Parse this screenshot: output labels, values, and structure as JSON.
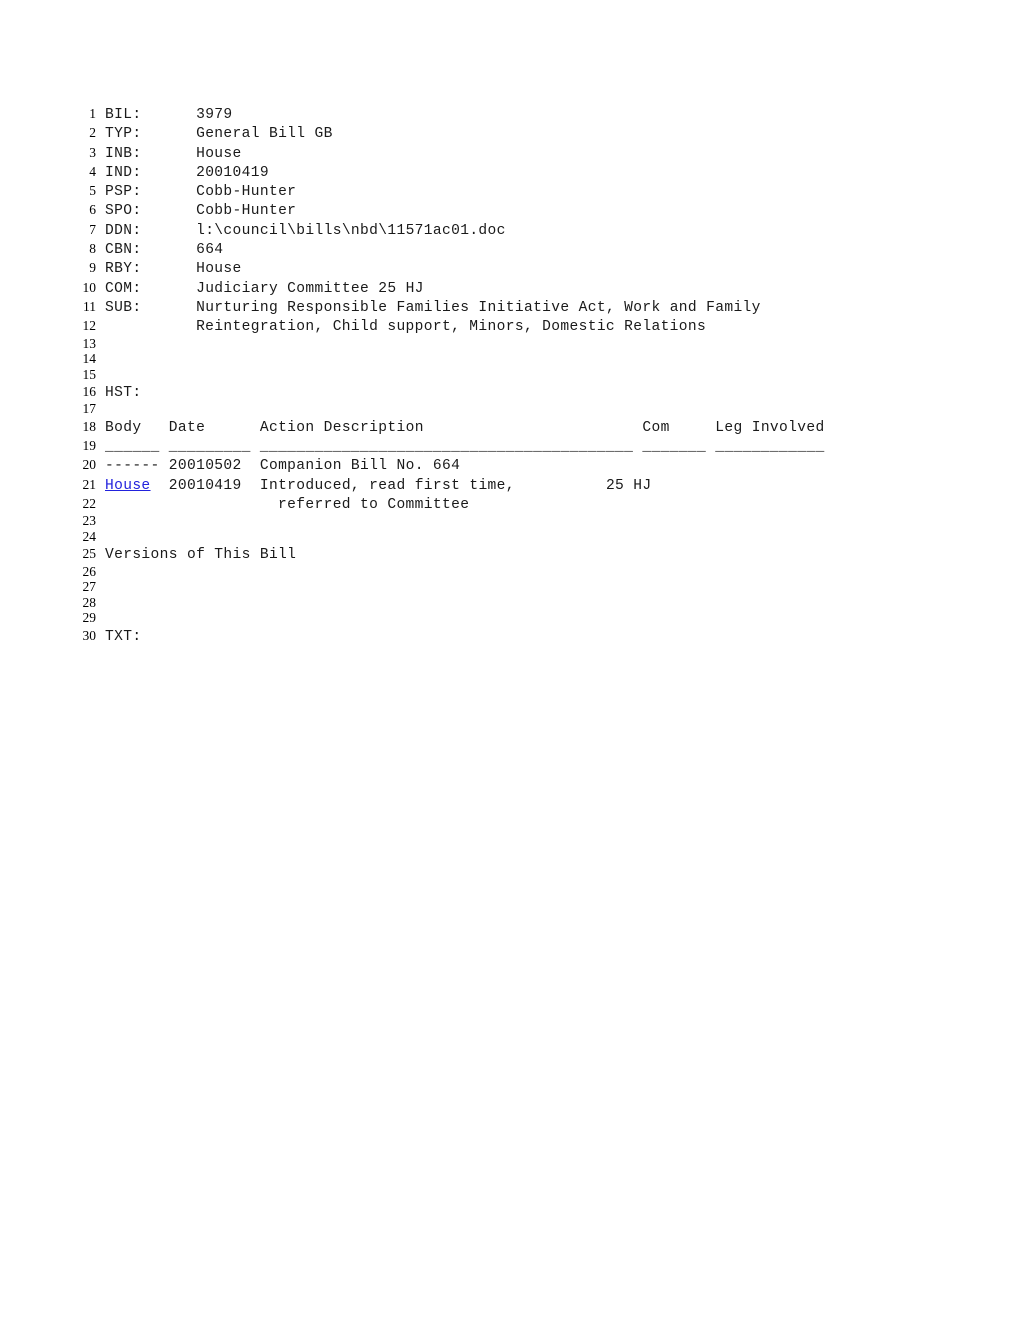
{
  "document": {
    "type": "legislative-bill-record",
    "fields": {
      "bill_number_label": "BIL:",
      "bill_number_value": "3979",
      "type_label": "TYP:",
      "type_value": "General Bill GB",
      "introduced_body_label": "INB:",
      "introduced_body_value": "House",
      "introduced_date_label": "IND:",
      "introduced_date_value": "20010419",
      "primary_sponsor_label": "PSP:",
      "primary_sponsor_value": "Cobb-Hunter",
      "sponsor_label": "SPO:",
      "sponsor_value": "Cobb-Hunter",
      "document_name_label": "DDN:",
      "document_name_value": "l:\\council\\bills\\nbd\\11571ac01.doc",
      "companion_bill_label": "CBN:",
      "companion_bill_value": "664",
      "referred_by_label": "RBY:",
      "referred_by_value": "House",
      "committee_label": "COM:",
      "committee_value": "Judiciary Committee 25 HJ",
      "subject_label": "SUB:",
      "subject_value_line1": "Nurturing Responsible Families Initiative Act, Work and Family",
      "subject_value_line2": "Reintegration, Child support, Minors, Domestic Relations"
    },
    "history": {
      "section_label": "HST:",
      "columns": {
        "body": "Body",
        "date": "Date",
        "action": "Action Description",
        "com": "Com",
        "leg": "Leg Involved"
      },
      "rules": {
        "body": "______",
        "date": "_________",
        "action": "_________________________________________",
        "com": "_______",
        "leg": "____________"
      },
      "rows": [
        {
          "body": "------",
          "body_is_link": false,
          "date": "20010502",
          "action": "Companion Bill No. 664",
          "action_cont": "",
          "com": "",
          "leg": ""
        },
        {
          "body": "House",
          "body_is_link": true,
          "date": "20010419",
          "action": "Introduced, read first time,",
          "action_cont": "referred to Committee",
          "com": "25 HJ",
          "leg": ""
        }
      ]
    },
    "versions_heading": "Versions of This Bill",
    "text_section_label": "TXT:",
    "line_numbers": [
      "1",
      "2",
      "3",
      "4",
      "5",
      "6",
      "7",
      "8",
      "9",
      "10",
      "11",
      "12",
      "13",
      "14",
      "15",
      "16",
      "17",
      "18",
      "19",
      "20",
      "21",
      "22",
      "23",
      "24",
      "25",
      "26",
      "27",
      "28",
      "29",
      "30"
    ]
  },
  "colors": {
    "link": "#2222dd",
    "text": "#1a1a1a",
    "line_number": "#000000",
    "background": "#ffffff"
  }
}
